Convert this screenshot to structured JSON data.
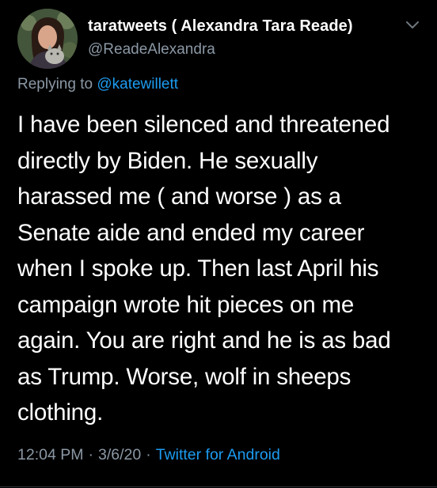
{
  "tweet": {
    "display_name": "taratweets ( Alexandra Tara Reade)",
    "handle": "@ReadeAlexandra",
    "replying_prefix": "Replying to",
    "replying_to": "@katewillett",
    "text": "I have been silenced and threatened\ndirectly by Biden. He sexually\nharassed me  ( and worse ) as a\nSenate aide and ended my career\nwhen I spoke up.  Then last April his\ncampaign wrote hit pieces on me\nagain. You are right and he is as bad\nas Trump. Worse, wolf in sheeps\nclothing.",
    "time": "12:04 PM",
    "date": "3/6/20",
    "separator": "·",
    "source": "Twitter for Android"
  },
  "icons": {
    "caret": "chevron-down-icon",
    "avatar": "avatar"
  },
  "colors": {
    "background": "#000000",
    "primary_text": "#ffffff",
    "secondary_text": "#8b98a5",
    "accent": "#1d9bf0"
  }
}
